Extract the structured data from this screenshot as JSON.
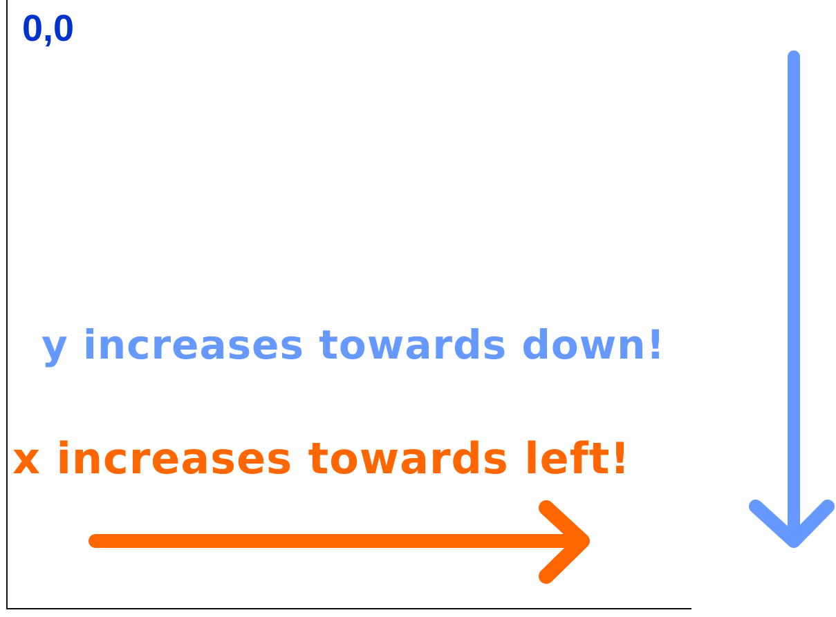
{
  "colors": {
    "origin": "#0033cc",
    "y_axis": "#6699ff",
    "x_axis": "#ff6600",
    "frame": "#111111"
  },
  "labels": {
    "origin": "0,0",
    "y_direction": "y increases towards down!",
    "x_direction": "x increases towards left!"
  },
  "icons": {
    "down_arrow": "arrow-down-icon",
    "right_arrow": "arrow-right-icon"
  }
}
